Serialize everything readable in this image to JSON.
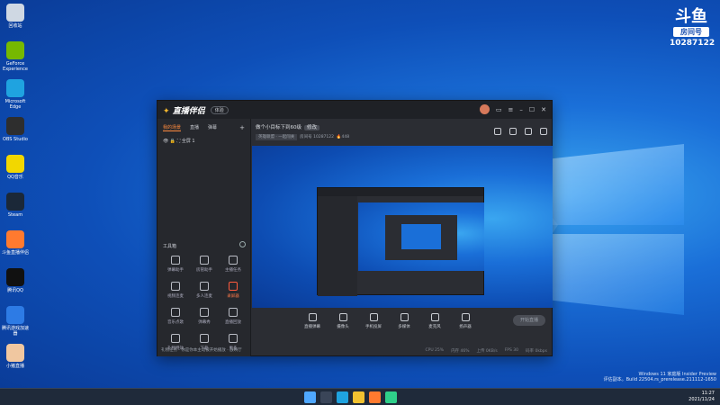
{
  "desktop": {
    "icons": [
      {
        "label": "回收站",
        "color": "#cfd8e3",
        "icon": "recycle-bin-icon"
      },
      {
        "label": "GeForce Experience",
        "color": "#76b900",
        "icon": "geforce-icon"
      },
      {
        "label": "Microsoft Edge",
        "color": "#1fa3e0",
        "icon": "edge-icon"
      },
      {
        "label": "OBS Studio",
        "color": "#2e2e2e",
        "icon": "obs-icon"
      },
      {
        "label": "QQ音乐",
        "color": "#f2d700",
        "icon": "qq-music-icon"
      },
      {
        "label": "Steam",
        "color": "#1b2838",
        "icon": "steam-icon"
      },
      {
        "label": "斗鱼直播伴侣",
        "color": "#ff7a2f",
        "icon": "douyu-companion-icon"
      },
      {
        "label": "腾讯QQ",
        "color": "#111111",
        "icon": "qq-icon"
      },
      {
        "label": "腾讯游戏加速器",
        "color": "#2d7be5",
        "icon": "game-accelerator-icon"
      },
      {
        "label": "小猪直播",
        "color": "#f0c7a0",
        "icon": "pig-icon"
      }
    ]
  },
  "brand": {
    "logo": "斗鱼",
    "badge": "房间号",
    "room_number": "10287122"
  },
  "watermark": {
    "line1": "Windows 11 家庭版 Insider Preview",
    "line2": "评估副本。Build 22504.rs_prerelease.211112-1650"
  },
  "tray": {
    "time": "11:27",
    "date": "2021/11/24"
  },
  "app": {
    "name_prefix": "直播伴侣",
    "version_badge": "体验",
    "tabs": [
      "我的场景",
      "直播",
      "弹幕"
    ],
    "add_label": "+",
    "scene_name": "全屏 1",
    "tools_header": "工具箱",
    "tools": [
      {
        "label": "弹幕助手"
      },
      {
        "label": "房管助手"
      },
      {
        "label": "主播任务"
      },
      {
        "label": "视频连麦"
      },
      {
        "label": "多人连麦"
      },
      {
        "label": "录屏器",
        "active": true
      },
      {
        "label": "音乐点歌"
      },
      {
        "label": "弹幕秀"
      },
      {
        "label": "直播回放"
      },
      {
        "label": "礼物特效"
      },
      {
        "label": "下载"
      },
      {
        "label": "更多"
      }
    ],
    "left_footer": "礼物任务 · 你是你本主动被开始播放 · 放映厅",
    "room_title": "做个小目标下到60级",
    "room_tag": "修改",
    "room_category": "英雄联盟 · 一起闯关",
    "room_id_label": "房间号",
    "room_id": "10287122",
    "heat": "448",
    "controls": [
      {
        "label": "直播弹幕"
      },
      {
        "label": "摄像头"
      },
      {
        "label": "手机投屏"
      },
      {
        "label": "多媒体"
      },
      {
        "label": "麦克风"
      },
      {
        "label": "扬声器"
      }
    ],
    "start_button": "开始直播",
    "status": [
      "CPU 25%",
      "内存 46%",
      "上传 0KB/s",
      "FPS 30",
      "码率 0kbps"
    ]
  }
}
